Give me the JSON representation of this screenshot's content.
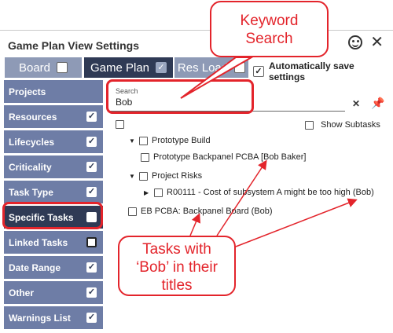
{
  "dialog": {
    "title": "Game Plan View Settings",
    "icons": [
      "smiley-icon",
      "close-icon"
    ]
  },
  "tabs": [
    {
      "label": "Board",
      "checked": false
    },
    {
      "label": "Game Plan",
      "checked": true
    },
    {
      "label": "Res Load",
      "checked": false
    }
  ],
  "autosave": {
    "label": "Automatically save settings",
    "checked": true
  },
  "sidebar": {
    "items": [
      {
        "label": "Projects",
        "checked": null
      },
      {
        "label": "Resources",
        "checked": true
      },
      {
        "label": "Lifecycles",
        "checked": true
      },
      {
        "label": "Criticality",
        "checked": true
      },
      {
        "label": "Task Type",
        "checked": true
      },
      {
        "label": "Specific Tasks",
        "checked": false
      },
      {
        "label": "Linked Tasks",
        "checked": false
      },
      {
        "label": "Date Range",
        "checked": true
      },
      {
        "label": "Other",
        "checked": true
      },
      {
        "label": "Warnings List",
        "checked": true
      }
    ]
  },
  "search": {
    "label": "Search",
    "value": "Bob",
    "clear_glyph": "✕",
    "pin_glyph": "📌"
  },
  "show_subtasks": {
    "label": "Show Subtasks",
    "checked": false
  },
  "tree": [
    {
      "label": "Prototype Build",
      "expanded": true
    },
    {
      "label": "Prototype Backpanel PCBA [Bob Baker]"
    },
    {
      "label": "Project Risks",
      "expanded": true
    },
    {
      "label": "R00111 - Cost of subsystem A might be too high (Bob)",
      "expanded": false
    },
    {
      "label": "EB PCBA: Backpanel Board (Bob)"
    }
  ],
  "annotations": {
    "keyword_search": "Keyword Search",
    "keyword_search_line1": "Keyword",
    "keyword_search_line2": "Search",
    "tasks_with_bob_line1": "Tasks with",
    "tasks_with_bob_line2": "‘Bob’ in their",
    "tasks_with_bob_line3": "titles",
    "accent_color": "#e3242b"
  }
}
